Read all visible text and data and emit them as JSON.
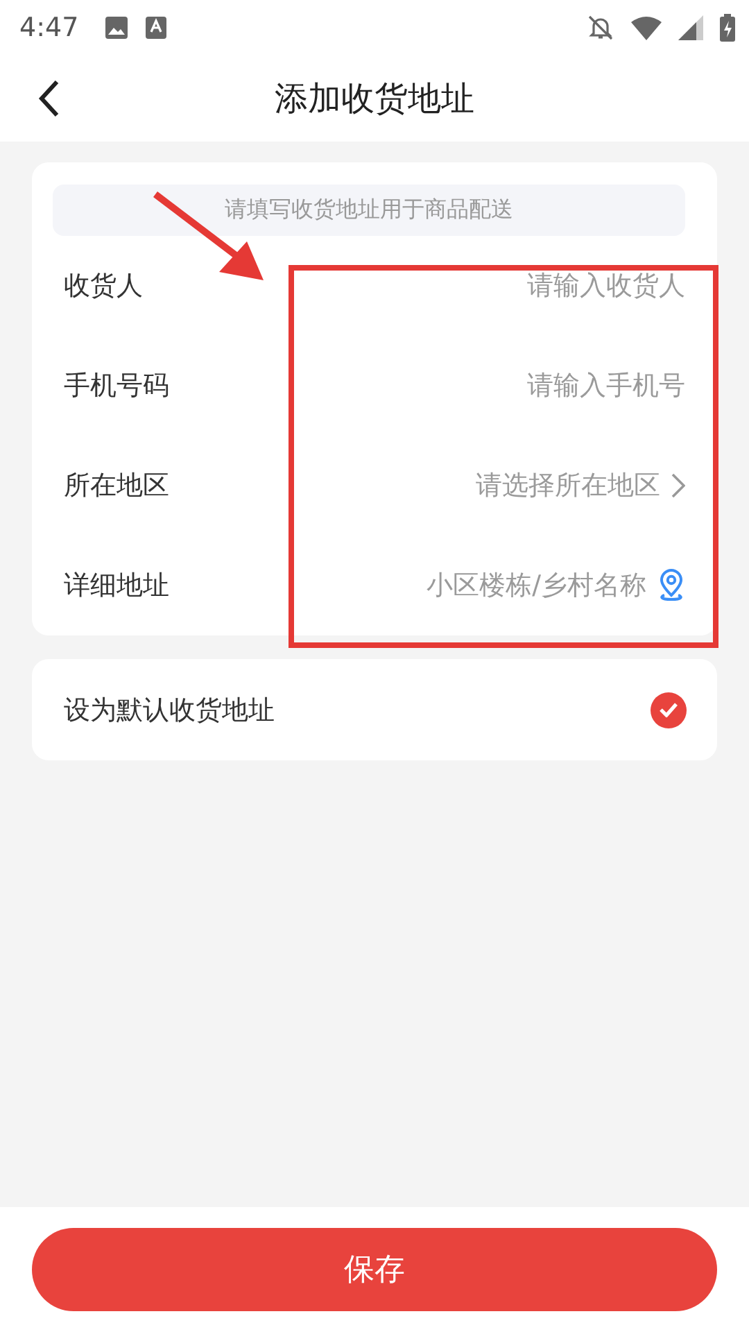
{
  "status_bar": {
    "time": "4:47"
  },
  "header": {
    "title": "添加收货地址"
  },
  "notice": "请填写收货地址用于商品配送",
  "fields": [
    {
      "label": "收货人",
      "placeholder": "请输入收货人",
      "kind": "input"
    },
    {
      "label": "手机号码",
      "placeholder": "请输入手机号",
      "kind": "input"
    },
    {
      "label": "所在地区",
      "placeholder": "请选择所在地区",
      "kind": "select"
    },
    {
      "label": "详细地址",
      "placeholder": "小区楼栋/乡村名称",
      "kind": "location"
    }
  ],
  "default_address": {
    "label": "设为默认收货地址",
    "checked": true
  },
  "save_button": "保存"
}
